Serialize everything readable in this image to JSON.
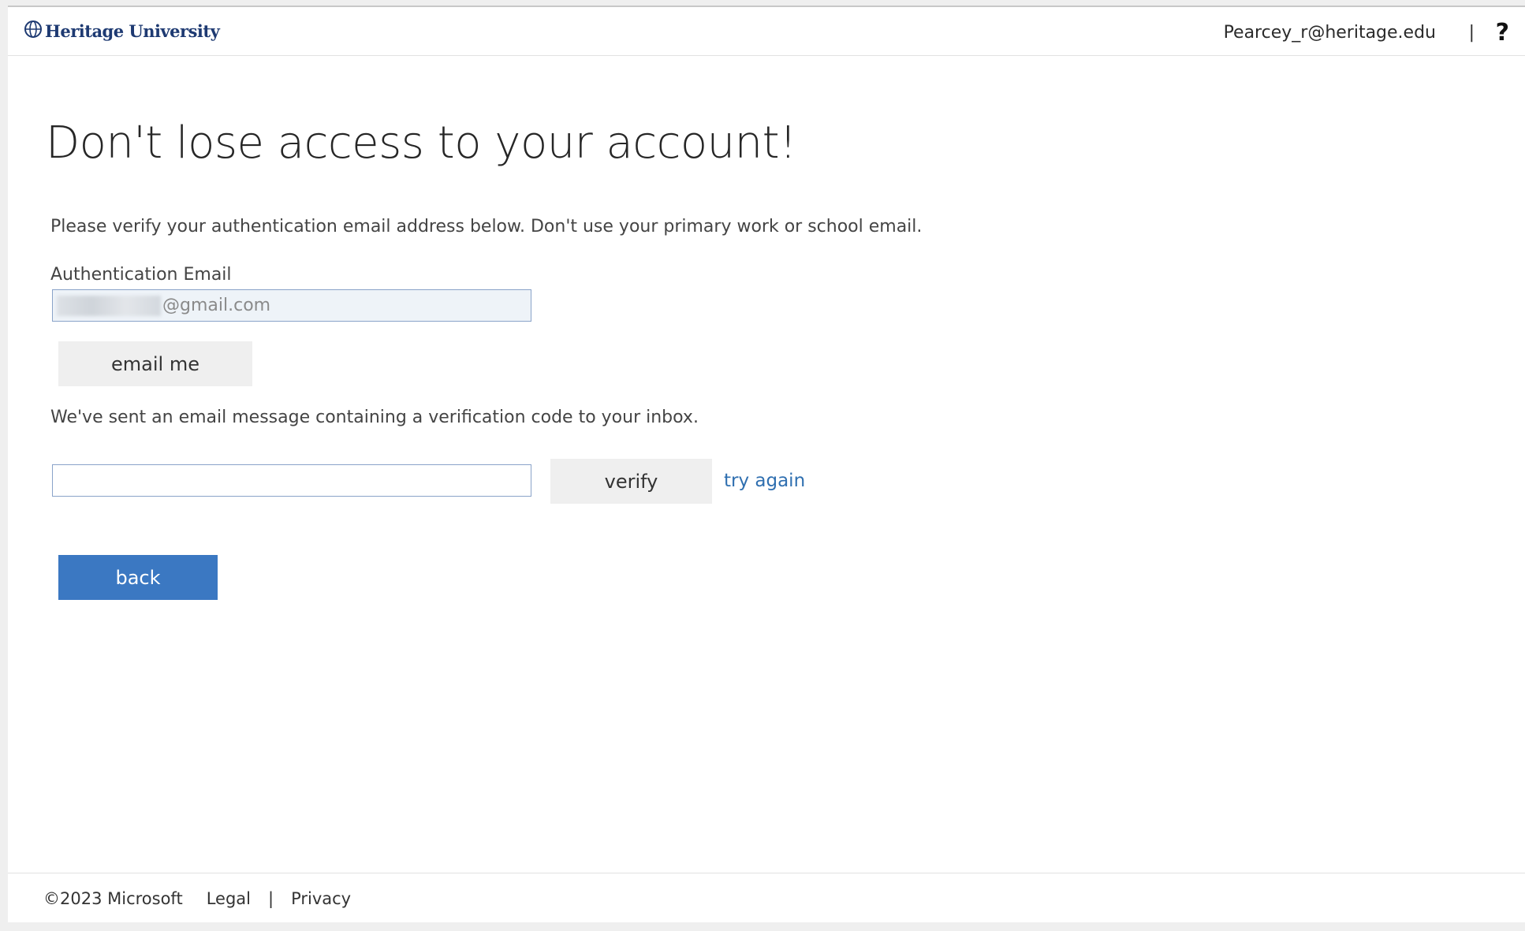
{
  "header": {
    "logo_text": "Heritage University",
    "logo_icon": "globe-icon",
    "user_email": "Pearcey_r@heritage.edu",
    "separator": "|",
    "help_label": "?"
  },
  "main": {
    "title": "Don't lose access to your account!",
    "instructions": "Please verify your authentication email address below. Don't use your primary work or school email.",
    "email_label": "Authentication Email",
    "email_value_suffix": "@gmail.com",
    "email_me_label": "email me",
    "sent_message": "We've sent an email message containing a verification code to your inbox.",
    "code_value": "",
    "verify_label": "verify",
    "try_again_label": "try again",
    "back_label": "back"
  },
  "footer": {
    "copyright": "©2023 Microsoft",
    "legal": "Legal",
    "separator": "|",
    "privacy": "Privacy"
  },
  "colors": {
    "accent": "#3b78c2",
    "link": "#2f6fb0",
    "logo": "#1e3a72"
  }
}
